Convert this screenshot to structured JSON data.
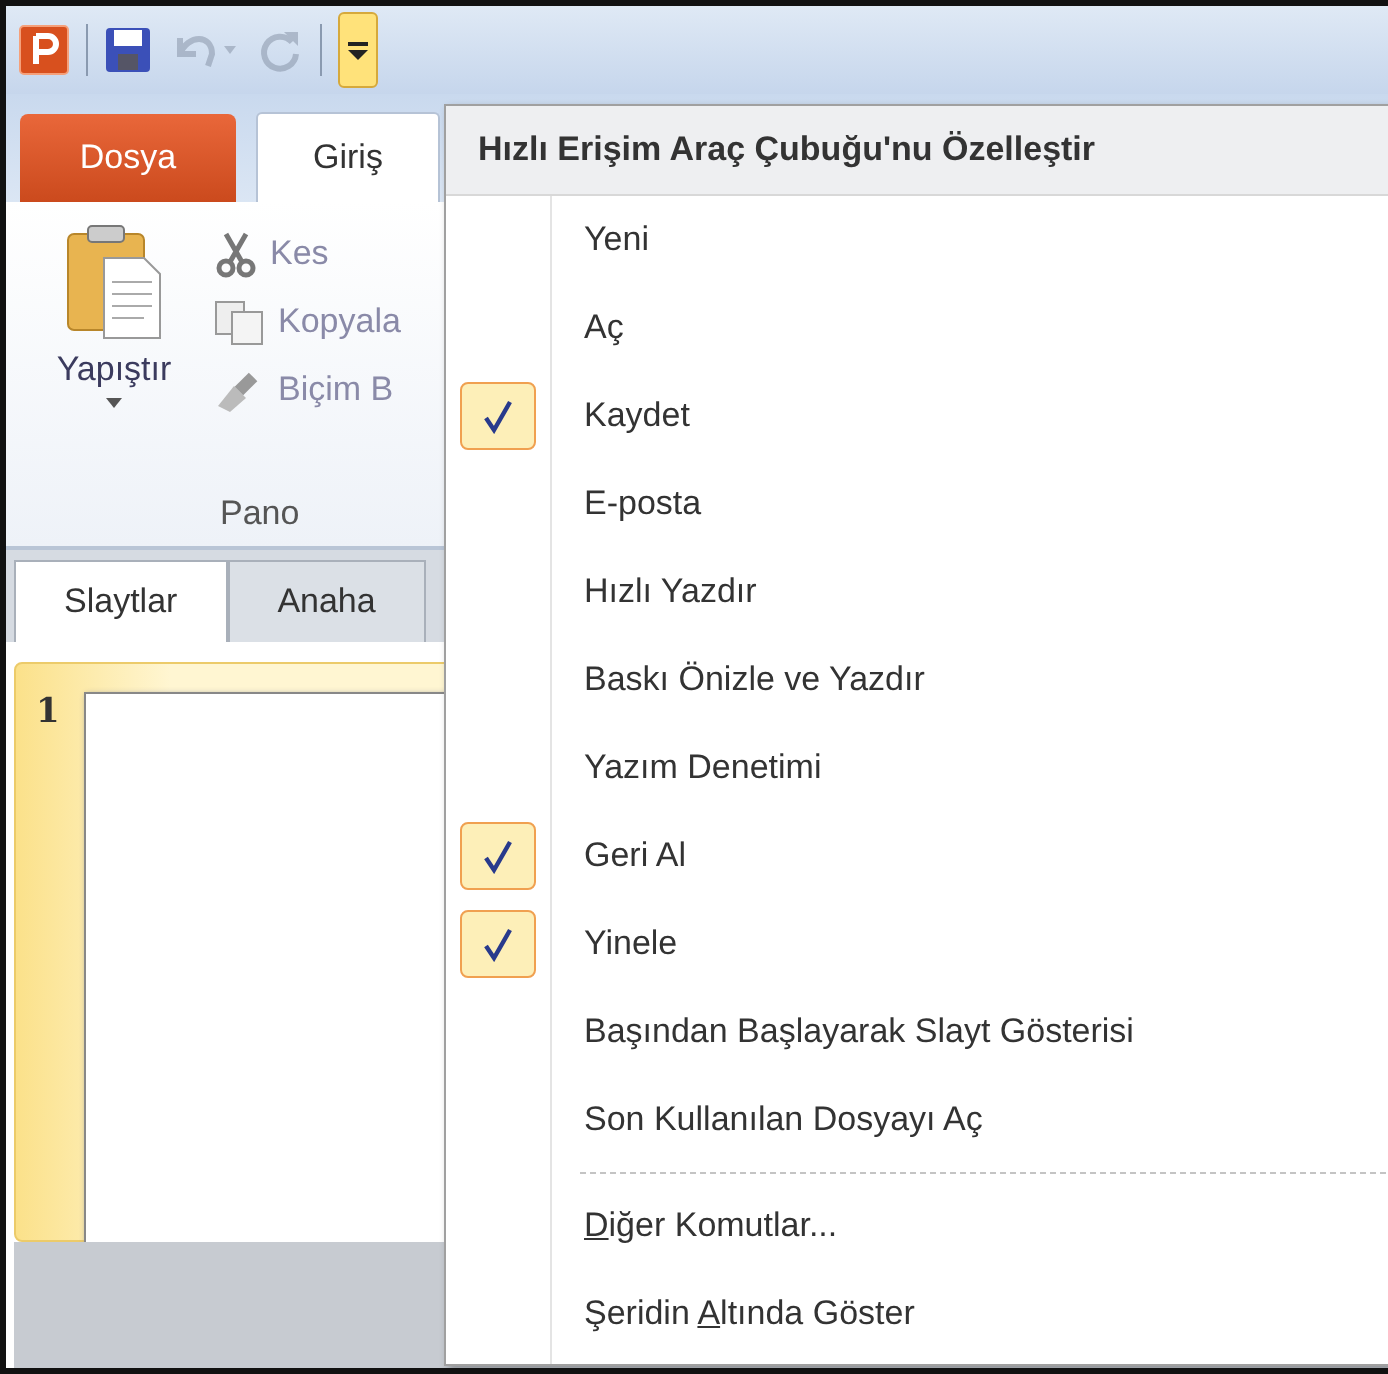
{
  "quick_access": {
    "items": [
      {
        "kind": "save",
        "disabled": false
      },
      {
        "kind": "undo",
        "disabled": true
      },
      {
        "kind": "redo",
        "disabled": true
      }
    ],
    "customize_pressed": true
  },
  "ribbon": {
    "tabs": [
      {
        "label": "Dosya",
        "kind": "file",
        "selected": false
      },
      {
        "label": "Giriş",
        "kind": "tab",
        "selected": true
      }
    ],
    "paste": "Yapıştır",
    "commands": [
      {
        "label": "Kes",
        "kind": "cut",
        "disabled": true
      },
      {
        "label": "Kopyala",
        "kind": "copy",
        "disabled": true
      },
      {
        "label": "Biçim B",
        "kind": "brush",
        "disabled": true
      }
    ],
    "group": "Pano"
  },
  "panel_tabs": [
    {
      "label": "Slaytlar",
      "selected": true
    },
    {
      "label": "Anaha",
      "selected": false
    }
  ],
  "slides": [
    {
      "number": "1",
      "selected": true
    }
  ],
  "menu": {
    "title": "Hızlı Erişim Araç Çubuğu'nu Özelleştir",
    "items": [
      {
        "label": "Yeni",
        "checked": false
      },
      {
        "label": "Aç",
        "checked": false
      },
      {
        "label": "Kaydet",
        "checked": true
      },
      {
        "label": "E-posta",
        "checked": false
      },
      {
        "label": "Hızlı Yazdır",
        "checked": false
      },
      {
        "label": "Baskı Önizle ve Yazdır",
        "checked": false
      },
      {
        "label": "Yazım Denetimi",
        "checked": false
      },
      {
        "label": "Geri Al",
        "checked": true
      },
      {
        "label": "Yinele",
        "checked": true
      },
      {
        "label": "Başından Başlayarak Slayt Gösterisi",
        "checked": false
      },
      {
        "label": "Son Kullanılan Dosyayı Aç",
        "checked": false
      }
    ],
    "footer": [
      {
        "access_key": "D",
        "rest": "iğer Komutlar..."
      },
      {
        "prefix": "Şeridin ",
        "access_key": "A",
        "rest": "ltında Göster"
      }
    ]
  }
}
